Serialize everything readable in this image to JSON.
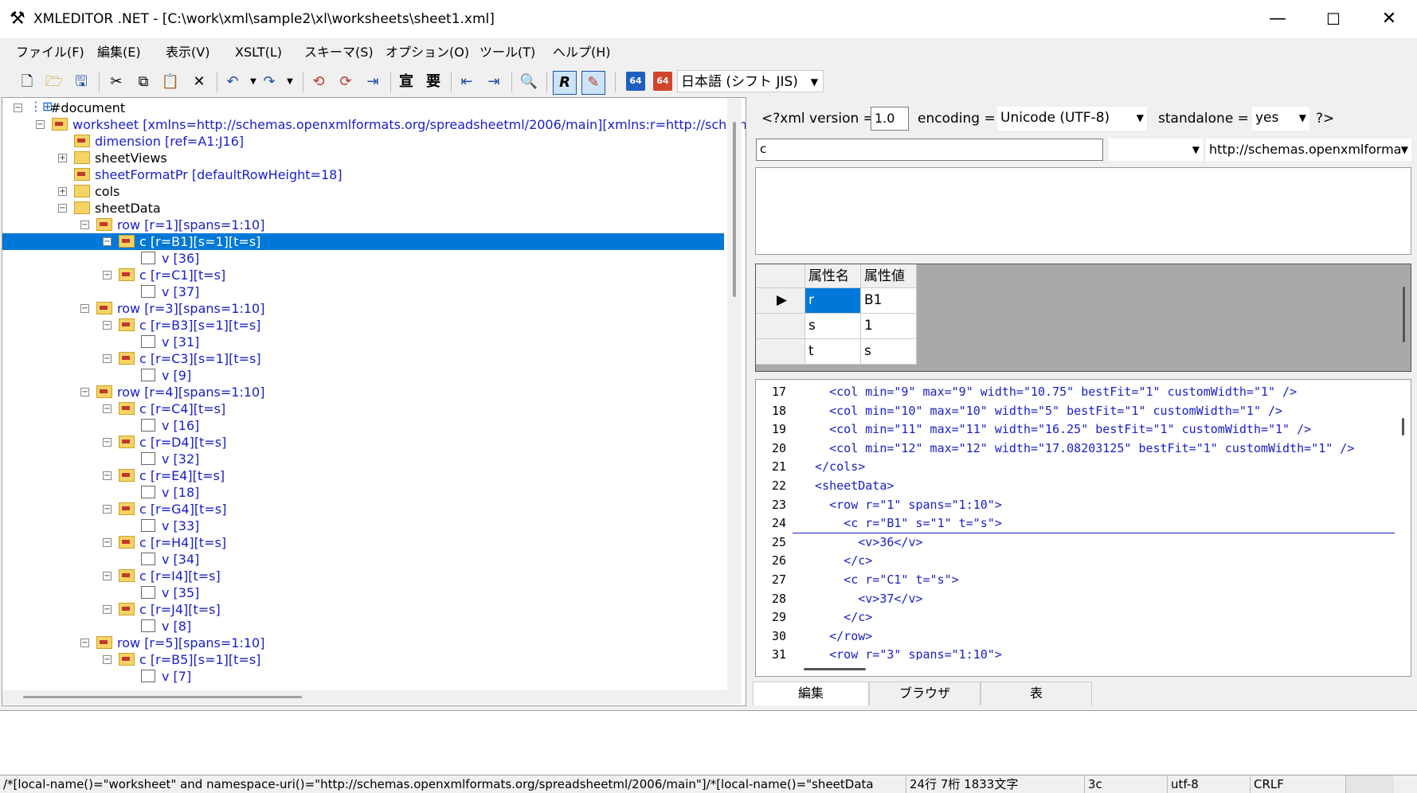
{
  "window": {
    "title": "XMLEDITOR .NET - [C:\\work\\xml\\sample2\\xl\\worksheets\\sheet1.xml]",
    "minimize": "—",
    "maximize": "☐",
    "close": "✕"
  },
  "menu": [
    "ファイル(F)",
    "編集(E)",
    "表示(V)",
    "XSLT(L)",
    "スキーマ(S)",
    "オプション(O)",
    "ツール(T)",
    "ヘルプ(H)"
  ],
  "toolbar": {
    "encoding": "日本語 (シフト JIS)",
    "b64a": "64",
    "b64b": "64"
  },
  "tree": [
    {
      "label": "#document",
      "color": "black",
      "icon": "root-icon",
      "depth": 0,
      "box": "−"
    },
    {
      "label": "worksheet [xmlns=http://schemas.openxmlformats.org/spreadsheetml/2006/main][xmlns:r=http://schemas",
      "color": "blue",
      "icon": "element-icon",
      "depth": 1,
      "box": "−"
    },
    {
      "label": "dimension [ref=A1:J16]",
      "color": "blue",
      "icon": "element-icon",
      "depth": 2,
      "box": ""
    },
    {
      "label": "sheetViews",
      "color": "black",
      "icon": "folder-icon",
      "depth": 2,
      "box": "+"
    },
    {
      "label": "sheetFormatPr [defaultRowHeight=18]",
      "color": "blue",
      "icon": "element-icon",
      "depth": 2,
      "box": ""
    },
    {
      "label": "cols",
      "color": "black",
      "icon": "folder-icon",
      "depth": 2,
      "box": "+"
    },
    {
      "label": "sheetData",
      "color": "black",
      "icon": "folder-icon",
      "depth": 2,
      "box": "−"
    },
    {
      "label": "row [r=1][spans=1:10]",
      "color": "blue",
      "icon": "element-icon",
      "depth": 3,
      "box": "−"
    },
    {
      "label": "c [r=B1][s=1][t=s]",
      "color": "blue",
      "icon": "element-icon",
      "depth": 4,
      "box": "−",
      "selected": true
    },
    {
      "label": "v  [36]",
      "color": "blue",
      "icon": "text-icon",
      "depth": 5,
      "box": ""
    },
    {
      "label": "c [r=C1][t=s]",
      "color": "blue",
      "icon": "element-icon",
      "depth": 4,
      "box": "−"
    },
    {
      "label": "v  [37]",
      "color": "blue",
      "icon": "text-icon",
      "depth": 5,
      "box": ""
    },
    {
      "label": "row [r=3][spans=1:10]",
      "color": "blue",
      "icon": "element-icon",
      "depth": 3,
      "box": "−"
    },
    {
      "label": "c [r=B3][s=1][t=s]",
      "color": "blue",
      "icon": "element-icon",
      "depth": 4,
      "box": "−"
    },
    {
      "label": "v  [31]",
      "color": "blue",
      "icon": "text-icon",
      "depth": 5,
      "box": ""
    },
    {
      "label": "c [r=C3][s=1][t=s]",
      "color": "blue",
      "icon": "element-icon",
      "depth": 4,
      "box": "−"
    },
    {
      "label": "v  [9]",
      "color": "blue",
      "icon": "text-icon",
      "depth": 5,
      "box": ""
    },
    {
      "label": "row [r=4][spans=1:10]",
      "color": "blue",
      "icon": "element-icon",
      "depth": 3,
      "box": "−"
    },
    {
      "label": "c [r=C4][t=s]",
      "color": "blue",
      "icon": "element-icon",
      "depth": 4,
      "box": "−"
    },
    {
      "label": "v  [16]",
      "color": "blue",
      "icon": "text-icon",
      "depth": 5,
      "box": ""
    },
    {
      "label": "c [r=D4][t=s]",
      "color": "blue",
      "icon": "element-icon",
      "depth": 4,
      "box": "−"
    },
    {
      "label": "v  [32]",
      "color": "blue",
      "icon": "text-icon",
      "depth": 5,
      "box": ""
    },
    {
      "label": "c [r=E4][t=s]",
      "color": "blue",
      "icon": "element-icon",
      "depth": 4,
      "box": "−"
    },
    {
      "label": "v  [18]",
      "color": "blue",
      "icon": "text-icon",
      "depth": 5,
      "box": ""
    },
    {
      "label": "c [r=G4][t=s]",
      "color": "blue",
      "icon": "element-icon",
      "depth": 4,
      "box": "−"
    },
    {
      "label": "v  [33]",
      "color": "blue",
      "icon": "text-icon",
      "depth": 5,
      "box": ""
    },
    {
      "label": "c [r=H4][t=s]",
      "color": "blue",
      "icon": "element-icon",
      "depth": 4,
      "box": "−"
    },
    {
      "label": "v  [34]",
      "color": "blue",
      "icon": "text-icon",
      "depth": 5,
      "box": ""
    },
    {
      "label": "c [r=I4][t=s]",
      "color": "blue",
      "icon": "element-icon",
      "depth": 4,
      "box": "−"
    },
    {
      "label": "v  [35]",
      "color": "blue",
      "icon": "text-icon",
      "depth": 5,
      "box": ""
    },
    {
      "label": "c [r=J4][t=s]",
      "color": "blue",
      "icon": "element-icon",
      "depth": 4,
      "box": "−"
    },
    {
      "label": "v  [8]",
      "color": "blue",
      "icon": "text-icon",
      "depth": 5,
      "box": ""
    },
    {
      "label": "row [r=5][spans=1:10]",
      "color": "blue",
      "icon": "element-icon",
      "depth": 3,
      "box": "−"
    },
    {
      "label": "c [r=B5][s=1][t=s]",
      "color": "blue",
      "icon": "element-icon",
      "depth": 4,
      "box": "−"
    },
    {
      "label": "v  [7]",
      "color": "blue",
      "icon": "text-icon",
      "depth": 5,
      "box": ""
    }
  ],
  "xmldecl": {
    "version_label": "<?xml version =",
    "version": "1.0",
    "encoding_label": "encoding =",
    "encoding": "Unicode (UTF-8)",
    "standalone_label": "standalone =",
    "standalone": "yes",
    "help": "?>"
  },
  "node": {
    "name": "c",
    "prefix": "",
    "namespace": "http://schemas.openxmlforma"
  },
  "attributes": {
    "headers": [
      "属性名",
      "属性値"
    ],
    "rows": [
      {
        "name": "r",
        "value": "B1"
      },
      {
        "name": "s",
        "value": "1"
      },
      {
        "name": "t",
        "value": "s"
      }
    ]
  },
  "editor": {
    "lines": [
      {
        "n": "17",
        "text": "    <col min=\"9\" max=\"9\" width=\"10.75\" bestFit=\"1\" customWidth=\"1\" />"
      },
      {
        "n": "18",
        "text": "    <col min=\"10\" max=\"10\" width=\"5\" bestFit=\"1\" customWidth=\"1\" />"
      },
      {
        "n": "19",
        "text": "    <col min=\"11\" max=\"11\" width=\"16.25\" bestFit=\"1\" customWidth=\"1\" />"
      },
      {
        "n": "20",
        "text": "    <col min=\"12\" max=\"12\" width=\"17.08203125\" bestFit=\"1\" customWidth=\"1\" />"
      },
      {
        "n": "21",
        "text": "  </cols>"
      },
      {
        "n": "22",
        "text": "  <sheetData>"
      },
      {
        "n": "23",
        "text": "    <row r=\"1\" spans=\"1:10\">"
      },
      {
        "n": "24",
        "text": "      <c r=\"B1\" s=\"1\" t=\"s\">"
      },
      {
        "n": "25",
        "text": "        <v>36</v>"
      },
      {
        "n": "26",
        "text": "      </c>"
      },
      {
        "n": "27",
        "text": "      <c r=\"C1\" t=\"s\">"
      },
      {
        "n": "28",
        "text": "        <v>37</v>"
      },
      {
        "n": "29",
        "text": "      </c>"
      },
      {
        "n": "30",
        "text": "    </row>"
      },
      {
        "n": "31",
        "text": "    <row r=\"3\" spans=\"1:10\">"
      }
    ]
  },
  "tabs": [
    "編集",
    "ブラウザ",
    "表"
  ],
  "status": {
    "xpath": "/*[local-name()=\"worksheet\" and namespace-uri()=\"http://schemas.openxmlformats.org/spreadsheetml/2006/main\"]/*[local-name()=\"sheetData",
    "pos": "24行   7桁   1833文字",
    "node": "3c",
    "enc": "utf-8",
    "eol": "CRLF"
  },
  "colors": {
    "selection": "#0078d7",
    "node_blue": "#1a20c8",
    "folder": "#f6d365"
  }
}
